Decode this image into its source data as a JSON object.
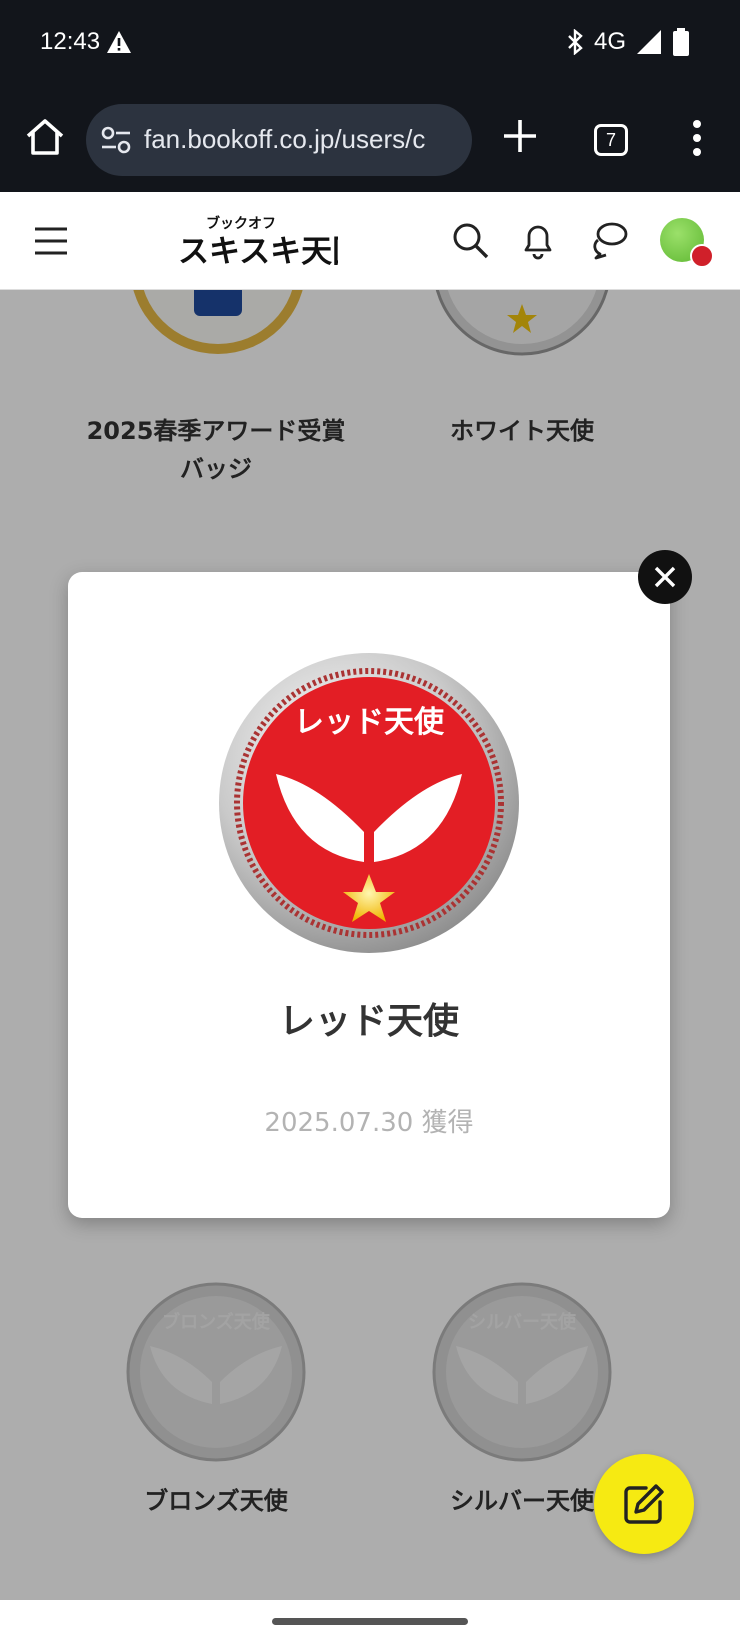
{
  "status_bar": {
    "time": "12:43",
    "network": "4G",
    "icons": [
      "warning-icon",
      "bluetooth-icon",
      "signal-icon",
      "battery-icon"
    ]
  },
  "browser": {
    "url": "fan.bookoff.co.jp/users/c",
    "tab_count": "7"
  },
  "site_header": {
    "logo_text": "スキスキ天国",
    "logo_subtext": "ブックオフ"
  },
  "badges": [
    {
      "name": "2025春季アワード受賞バッジ",
      "name_line1": "2025春季アワード受賞",
      "name_line2": "バッジ"
    },
    {
      "name": "ホワイト天使"
    },
    {
      "name": "ブロンズ天使",
      "medal_text": "ブロンズ天使"
    },
    {
      "name": "シルバー天使",
      "medal_text": "シルバー天使"
    }
  ],
  "modal": {
    "medal_text": "レッド天使",
    "title": "レッド天使",
    "date": "2025.07.30 獲得"
  },
  "colors": {
    "badge_red": "#e31e25",
    "fab_yellow": "#f6ea12",
    "status_bg": "#12151b"
  }
}
